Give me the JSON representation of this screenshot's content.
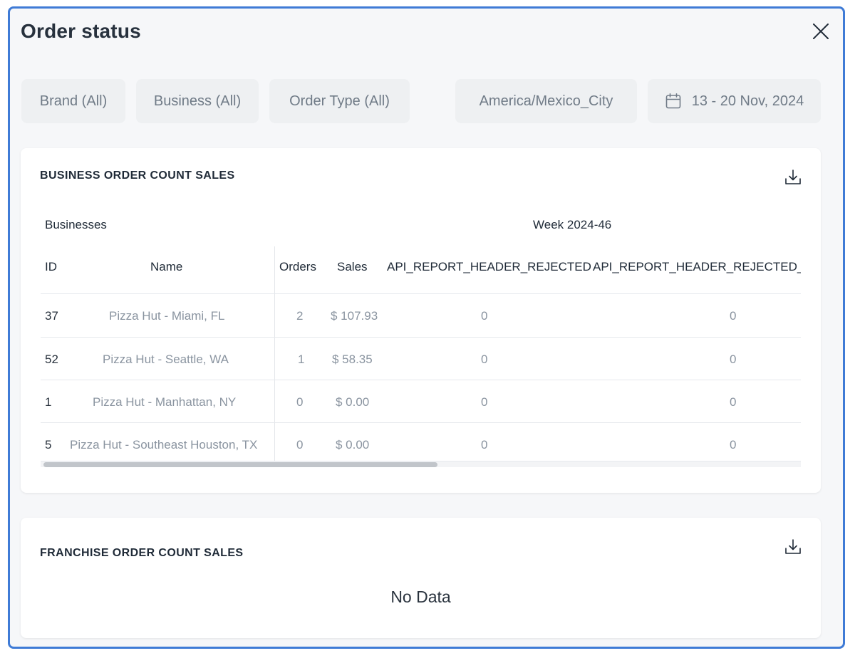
{
  "modal": {
    "title": "Order status"
  },
  "filters": {
    "brand": "Brand (All)",
    "business": "Business (All)",
    "order_type": "Order Type (All)",
    "timezone": "America/Mexico_City",
    "date_range": "13 - 20 Nov, 2024"
  },
  "business_card": {
    "title": "BUSINESS ORDER COUNT SALES",
    "group_businesses": "Businesses",
    "group_week": "Week 2024-46",
    "columns": {
      "id": "ID",
      "name": "Name",
      "orders": "Orders",
      "sales": "Sales",
      "rejected": "API_REPORT_HEADER_REJECTED",
      "rejected_2": "API_REPORT_HEADER_REJECTED_I"
    },
    "rows": [
      {
        "id": "37",
        "name": "Pizza Hut - Miami, FL",
        "orders": "2",
        "sales": "$ 107.93",
        "rejected": "0",
        "rejected_2": "0"
      },
      {
        "id": "52",
        "name": "Pizza Hut - Seattle, WA",
        "orders": "1",
        "sales": "$ 58.35",
        "rejected": "0",
        "rejected_2": "0"
      },
      {
        "id": "1",
        "name": "Pizza Hut - Manhattan, NY",
        "orders": "0",
        "sales": "$ 0.00",
        "rejected": "0",
        "rejected_2": "0"
      },
      {
        "id": "5",
        "name": "Pizza Hut - Southeast Houston, TX",
        "orders": "0",
        "sales": "$ 0.00",
        "rejected": "0",
        "rejected_2": "0"
      }
    ]
  },
  "franchise_card": {
    "title": "FRANCHISE ORDER COUNT SALES",
    "empty_text": "No Data"
  },
  "colors": {
    "modal_border": "#3f7bd6",
    "filter_bg": "#eef0f2",
    "text_primary": "#1f2a37",
    "text_muted": "#8a94a0"
  },
  "icons": [
    "close-icon",
    "calendar-icon",
    "download-icon"
  ]
}
